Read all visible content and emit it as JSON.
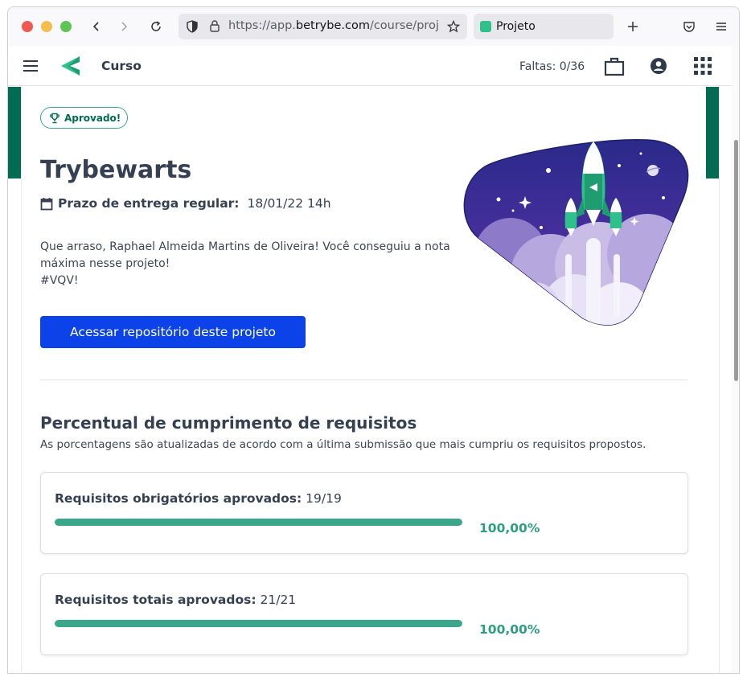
{
  "browser": {
    "url_prefix": "https://app.",
    "url_domain": "betrybe.com",
    "url_path": "/course/proje",
    "tab_title": "Projeto"
  },
  "header": {
    "title": "Curso",
    "faltas": "Faltas: 0/36"
  },
  "project": {
    "badge": "Aprovado!",
    "title": "Trybewarts",
    "deadline_label": "Prazo de entrega regular:",
    "deadline_value": "18/01/22 14h",
    "message": "Que arraso, Raphael Almeida Martins de Oliveira! Você conseguiu a nota máxima nesse projeto!",
    "hashtag": "#VQV!",
    "cta_label": "Acessar repositório deste projeto"
  },
  "requirements": {
    "title": "Percentual de cumprimento de requisitos",
    "subtitle": "As porcentagens são atualizadas de acordo com a última submissão que mais cumpriu os requisitos propostos.",
    "cards": [
      {
        "label": "Requisitos obrigatórios aprovados:",
        "count": "19/19",
        "percent_label": "100,00%",
        "progress": 1.0
      },
      {
        "label": "Requisitos totais aprovados:",
        "count": "21/21",
        "percent_label": "100,00%",
        "progress": 1.0
      }
    ]
  },
  "colors": {
    "brand_green": "#036b52",
    "accent_green": "#3aa68a",
    "cta_blue": "#0b43e8"
  }
}
